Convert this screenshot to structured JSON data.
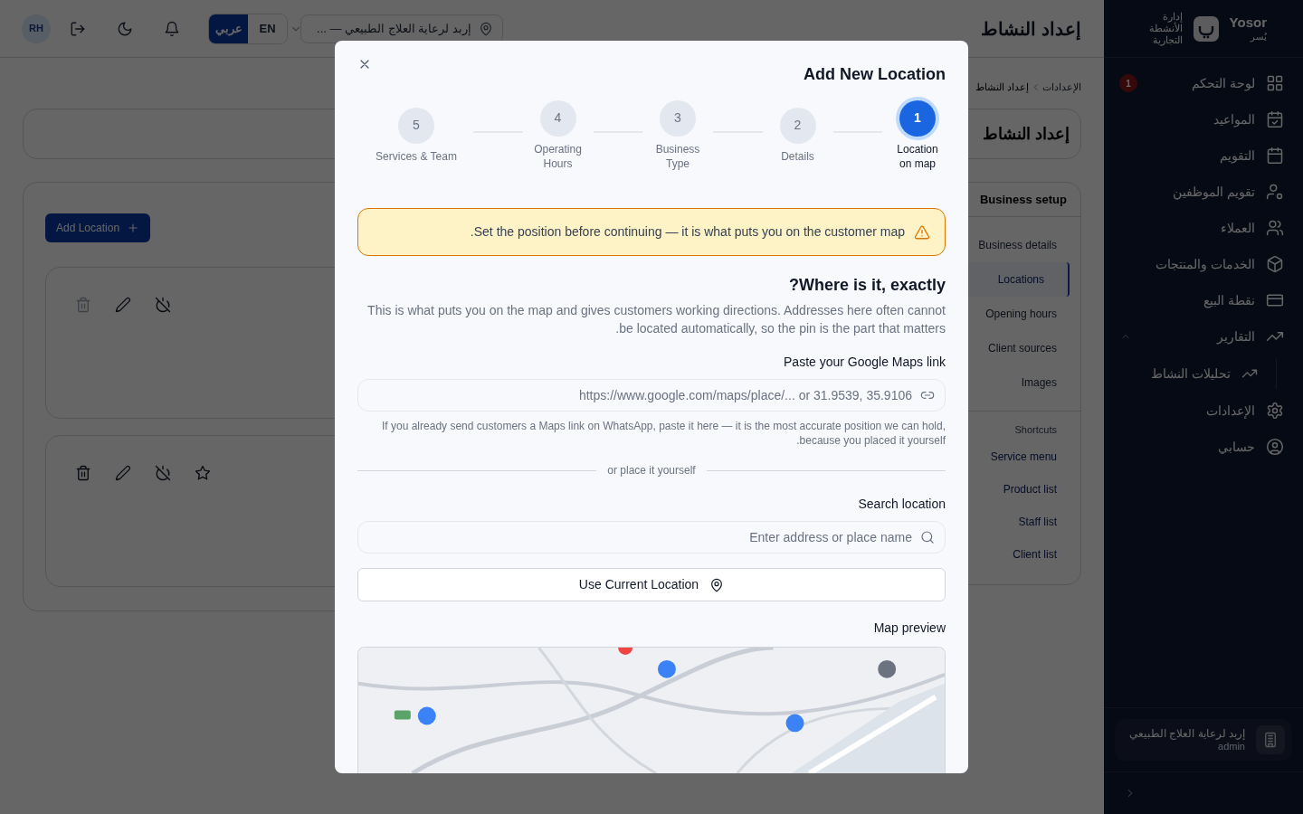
{
  "topbar": {
    "title": "إعداد النشاط",
    "branch_selector": "إربد لرعاية العلاج الطبيعي — ...",
    "languages": [
      {
        "label": "EN",
        "selected": false
      },
      {
        "label": "عربي",
        "selected": true
      }
    ],
    "avatar": "RH"
  },
  "breadcrumb": [
    "الإعدادات",
    "إعداد النشاط"
  ],
  "header_card": {
    "title": "إعداد النشاط"
  },
  "setup_nav": {
    "title": "Business setup",
    "items": [
      {
        "label": "Business details",
        "selected": false
      },
      {
        "label": "Locations",
        "selected": true
      },
      {
        "label": "Opening hours",
        "selected": false
      },
      {
        "label": "Client sources",
        "selected": false
      },
      {
        "label": "Images",
        "selected": false
      }
    ],
    "shortcuts_title": "Shortcuts",
    "shortcuts": [
      "Service menu",
      "Product list",
      "Staff list",
      "Client list"
    ]
  },
  "locations_panel": {
    "add_button": "Add Location",
    "cards": [
      {
        "delete_disabled": true,
        "show_star": false
      },
      {
        "delete_disabled": false,
        "show_star": true
      }
    ]
  },
  "sidebar": {
    "brand": "Yosor",
    "brand_arabic": "يُسر",
    "subtitle": "إدارة الأنشطة التجارية",
    "items": [
      {
        "label": "لوحة التحكم",
        "badge": "1"
      },
      {
        "label": "المواعيد"
      },
      {
        "label": "التقويم"
      },
      {
        "label": "تقويم الموظفين"
      },
      {
        "label": "العملاء"
      },
      {
        "label": "الخدمات والمنتجات"
      },
      {
        "label": "نقطة البيع"
      },
      {
        "label": "التقارير",
        "expanded": true,
        "children": [
          {
            "label": "تحليلات النشاط"
          }
        ]
      },
      {
        "label": "الإعدادات"
      },
      {
        "label": "حسابي"
      }
    ],
    "account": {
      "name": "إربد لرعاية العلاج الطبيعي",
      "role": "admin"
    }
  },
  "modal": {
    "title": "Add New Location",
    "steps": [
      {
        "number": "1",
        "label": "Location on map",
        "selected": true
      },
      {
        "number": "2",
        "label": "Details",
        "selected": false
      },
      {
        "number": "3",
        "label": "Business Type",
        "selected": false
      },
      {
        "number": "4",
        "label": "Operating Hours",
        "selected": false
      },
      {
        "number": "5",
        "label": "Services & Team",
        "selected": false
      }
    ],
    "warning": ".Set the position before continuing — it is what puts you on the customer map",
    "heading": "?Where is it, exactly",
    "description": "This is what puts you on the map and gives customers working directions. Addresses here often cannot .be located automatically, so the pin is the part that matters",
    "link_field": {
      "label": "Paste your Google Maps link",
      "placeholder": "https://www.google.com/maps/place/... or 31.9539, 35.9106"
    },
    "link_hint": "If you already send customers a Maps link on WhatsApp, paste it here — it is the most accurate position we can hold, .because you placed it yourself",
    "divider": "or place it yourself",
    "search_field": {
      "label": "Search location",
      "placeholder": "Enter address or place name"
    },
    "current_location_button": "Use Current Location",
    "map_label": "Map preview"
  }
}
